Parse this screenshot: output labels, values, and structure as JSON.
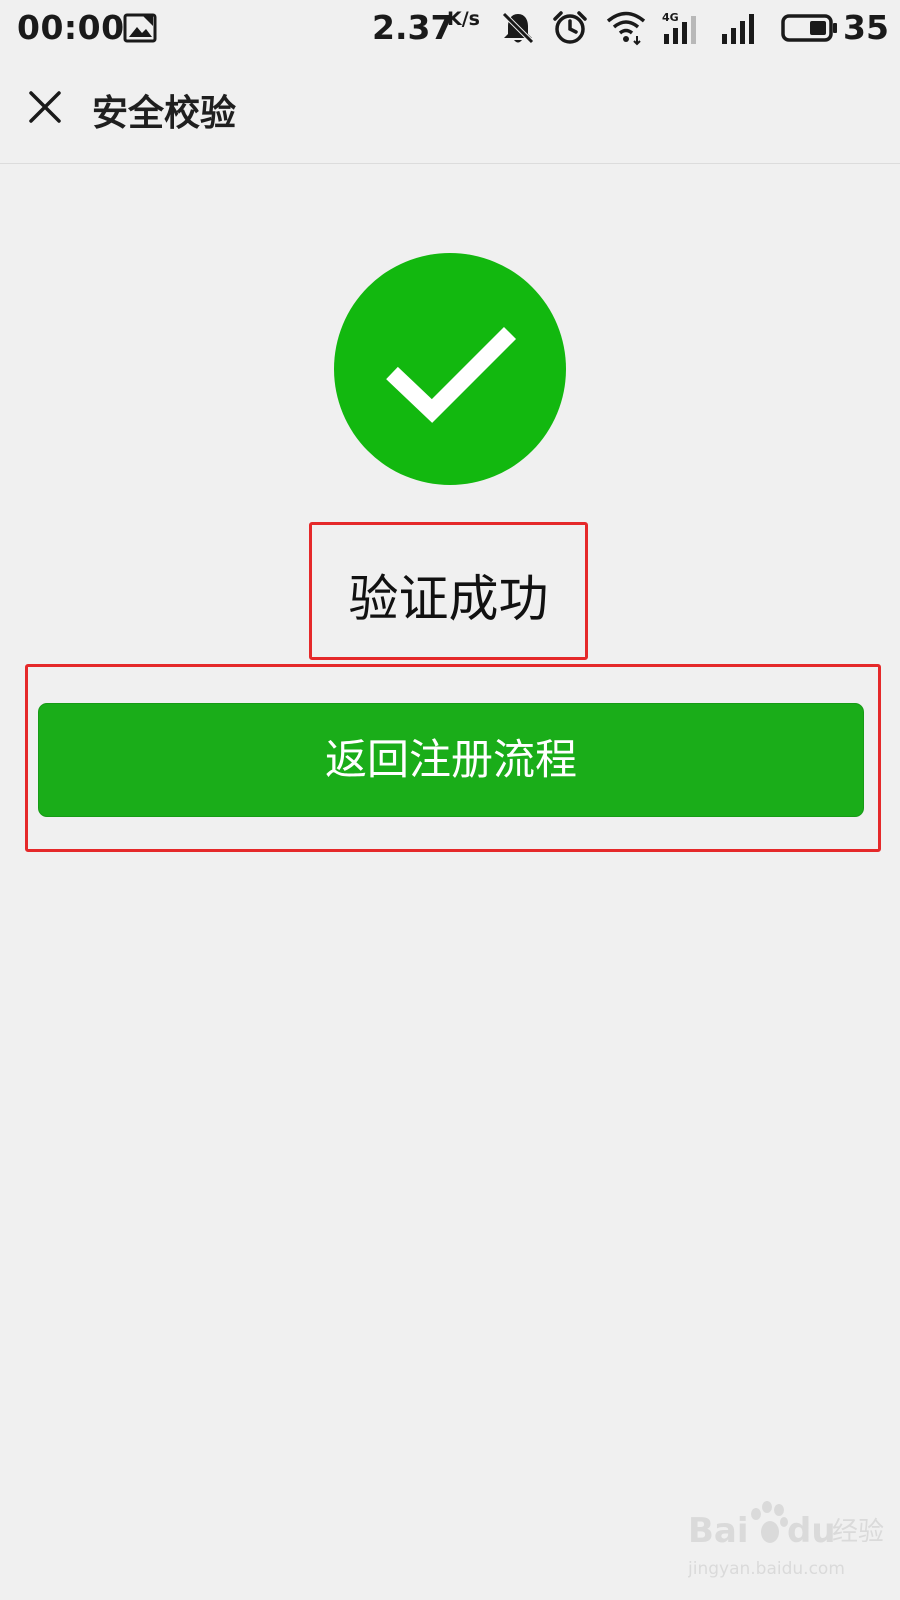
{
  "status_bar": {
    "time": "00:00",
    "network_speed": "2.37",
    "speed_unit": "K/s",
    "network_type": "4G",
    "battery_level": "35",
    "icons": [
      "photo-icon",
      "mute-bell-icon",
      "alarm-icon",
      "wifi-icon",
      "signal-4g-icon",
      "signal-icon",
      "battery-icon"
    ]
  },
  "header": {
    "close_icon": "close-icon",
    "title": "安全校验"
  },
  "main": {
    "status_icon": "checkmark-circle-icon",
    "status_color": "#12b80f",
    "status_text": "验证成功",
    "return_button_label": "返回注册流程",
    "button_color": "#1aad19"
  },
  "watermark": {
    "brand": "Bai",
    "brand2": "du",
    "service": "经验",
    "url": "jingyan.baidu.com"
  },
  "annotations": {
    "highlight_color": "#e5292a"
  }
}
